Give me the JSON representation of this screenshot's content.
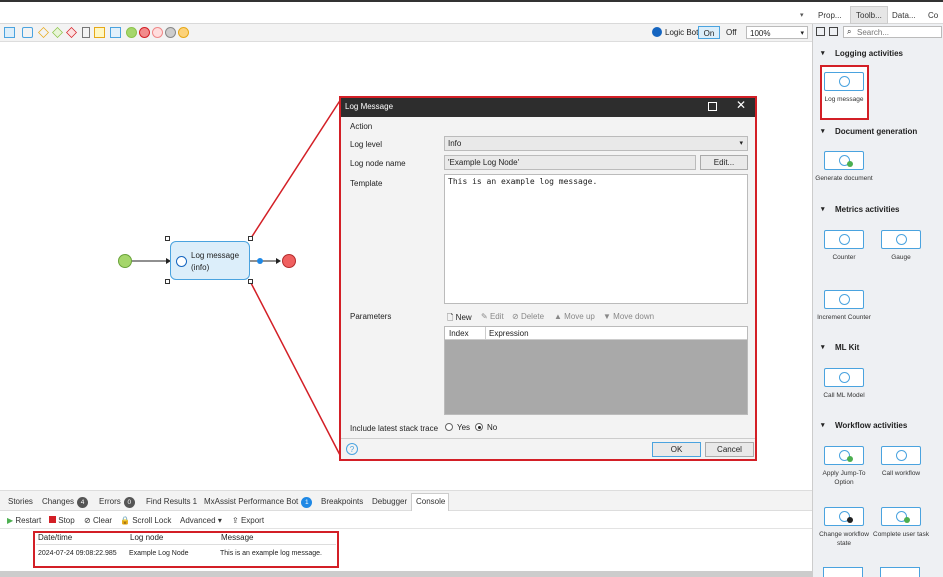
{
  "right_tabs": [
    "Prop...",
    "Toolb...",
    "Data...",
    "Co"
  ],
  "search": {
    "placeholder": "Search..."
  },
  "logic_bot": {
    "label": "Logic Bot",
    "on": "On",
    "off": "Off"
  },
  "zoom": "100%",
  "toolbox": {
    "sections": [
      {
        "title": "Logging activities",
        "items": [
          "Log message"
        ]
      },
      {
        "title": "Document generation",
        "items": [
          "Generate document"
        ]
      },
      {
        "title": "Metrics activities",
        "items": [
          "Counter",
          "Gauge",
          "Increment Counter"
        ]
      },
      {
        "title": "ML Kit",
        "items": [
          "Call ML Model"
        ]
      },
      {
        "title": "Workflow activities",
        "items": [
          "Apply Jump-To Option",
          "Call workflow",
          "Change workflow state",
          "Complete user task"
        ]
      }
    ]
  },
  "canvas": {
    "node_label": "Log message",
    "node_sublabel": "(info)"
  },
  "dialog": {
    "title": "Log Message",
    "group": "Action",
    "log_level_label": "Log level",
    "log_level_value": "Info",
    "node_name_label": "Log node name",
    "node_name_value": "'Example Log Node'",
    "edit_button": "Edit...",
    "template_label": "Template",
    "template_value": "This is an example log message.",
    "parameters_label": "Parameters",
    "param_toolbar": {
      "new": "New",
      "edit": "Edit",
      "delete": "Delete",
      "move_up": "Move up",
      "move_down": "Move down"
    },
    "param_columns": [
      "Index",
      "Expression"
    ],
    "stack_trace_label": "Include latest stack trace",
    "yes": "Yes",
    "no": "No",
    "ok": "OK",
    "cancel": "Cancel"
  },
  "bottom_tabs": [
    {
      "label": "Stories"
    },
    {
      "label": "Changes",
      "badge": "4"
    },
    {
      "label": "Errors",
      "badge": "0"
    },
    {
      "label": "Find Results 1"
    },
    {
      "label": "MxAssist Performance Bot",
      "badge": "1"
    },
    {
      "label": "Breakpoints"
    },
    {
      "label": "Debugger"
    },
    {
      "label": "Console"
    }
  ],
  "console_toolbar": {
    "restart": "Restart",
    "stop": "Stop",
    "clear": "Clear",
    "scroll_lock": "Scroll Lock",
    "advanced": "Advanced",
    "export": "Export"
  },
  "log_table": {
    "columns": [
      "Date/time",
      "Log node",
      "Message"
    ],
    "rows": [
      [
        "2024-07-24 09:08:22.985",
        "Example Log Node",
        "This is an example log message."
      ]
    ]
  },
  "colors": {
    "accent_red": "#d31f26",
    "accent_blue": "#4aa3df",
    "start_green": "#8bc34a",
    "end_red": "#f06060"
  }
}
